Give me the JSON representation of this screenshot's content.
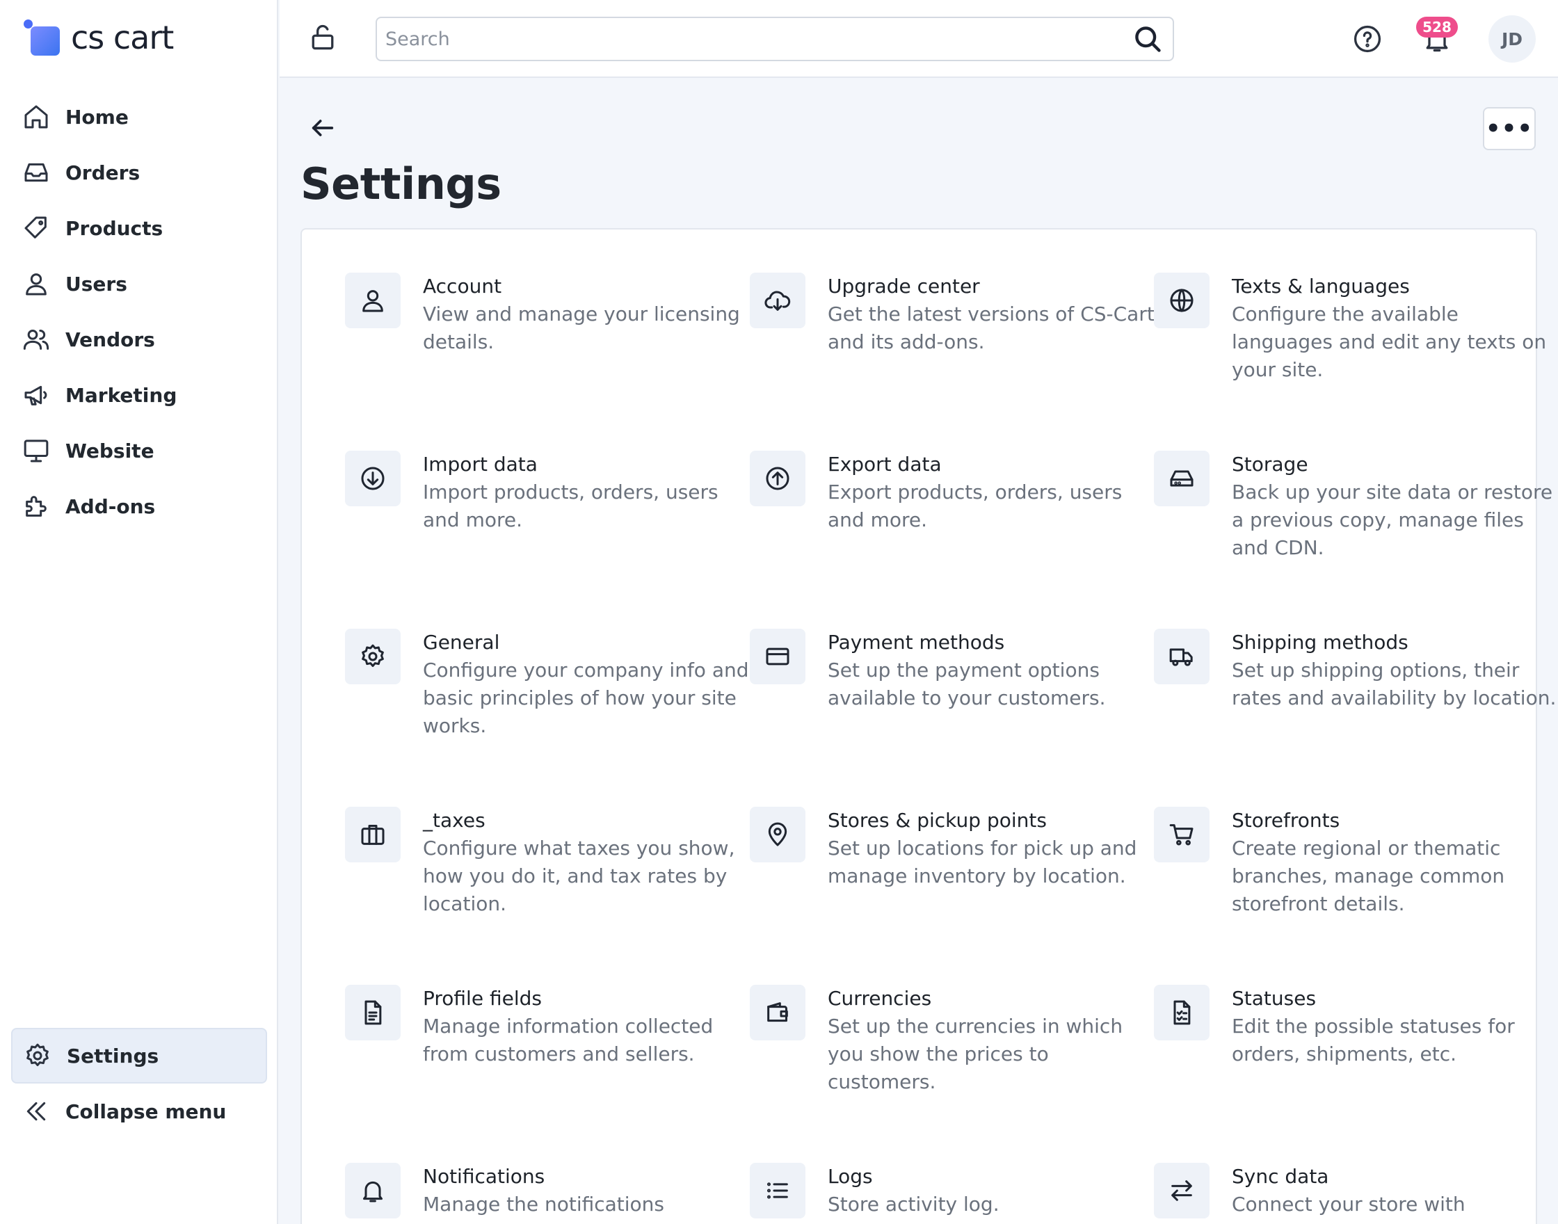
{
  "brand": {
    "name": "cs cart"
  },
  "sidebar": {
    "items": [
      {
        "label": "Home",
        "icon": "home-icon"
      },
      {
        "label": "Orders",
        "icon": "inbox-icon"
      },
      {
        "label": "Products",
        "icon": "tag-icon"
      },
      {
        "label": "Users",
        "icon": "user-icon"
      },
      {
        "label": "Vendors",
        "icon": "users-icon"
      },
      {
        "label": "Marketing",
        "icon": "megaphone-icon"
      },
      {
        "label": "Website",
        "icon": "monitor-icon"
      },
      {
        "label": "Add-ons",
        "icon": "puzzle-icon"
      }
    ],
    "settings_label": "Settings",
    "collapse_label": "Collapse menu"
  },
  "topbar": {
    "search_placeholder": "Search",
    "notification_count": "528",
    "avatar_initials": "JD"
  },
  "page": {
    "title": "Settings",
    "more_label": "•••"
  },
  "cards": [
    {
      "title": "Account",
      "desc": "View and manage your licensing details."
    },
    {
      "title": "Upgrade center",
      "desc": "Get the latest versions of CS-Cart and its add-ons."
    },
    {
      "title": "Texts & languages",
      "desc": "Configure the available languages and edit any texts on your site."
    },
    {
      "title": "Import data",
      "desc": "Import products, orders, users and more."
    },
    {
      "title": "Export data",
      "desc": "Export products, orders, users and more."
    },
    {
      "title": "Storage",
      "desc": "Back up your site data or restore a previous copy, manage files and CDN."
    },
    {
      "title": "General",
      "desc": "Configure your company info and basic principles of how your site works."
    },
    {
      "title": "Payment methods",
      "desc": "Set up the payment options available to your customers."
    },
    {
      "title": "Shipping methods",
      "desc": "Set up shipping options, their rates and availability by location."
    },
    {
      "title": "_taxes",
      "desc": "Configure what taxes you show, how you do it, and tax rates by location."
    },
    {
      "title": "Stores & pickup points",
      "desc": "Set up locations for pick up and manage inventory by location."
    },
    {
      "title": "Storefronts",
      "desc": "Create regional or thematic branches, manage common storefront details."
    },
    {
      "title": "Profile fields",
      "desc": "Manage information collected from customers and sellers."
    },
    {
      "title": "Currencies",
      "desc": "Set up the currencies in which you show the prices to customers."
    },
    {
      "title": "Statuses",
      "desc": "Edit the possible statuses for orders, shipments, etc."
    },
    {
      "title": "Notifications",
      "desc": "Manage the notifications"
    },
    {
      "title": "Logs",
      "desc": "Store activity log."
    },
    {
      "title": "Sync data",
      "desc": "Connect your store with"
    }
  ]
}
